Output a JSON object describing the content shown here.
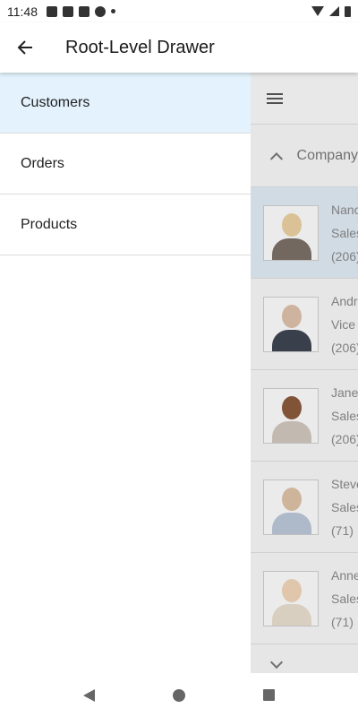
{
  "status_bar": {
    "time": "11:48"
  },
  "app_bar": {
    "title": "Root-Level Drawer",
    "back_icon": "arrow-left-icon"
  },
  "drawer": {
    "items": [
      {
        "label": "Customers",
        "active": true
      },
      {
        "label": "Orders",
        "active": false
      },
      {
        "label": "Products",
        "active": false
      }
    ]
  },
  "underlay": {
    "group_header": "Company",
    "rows": [
      {
        "line1": "Nanc",
        "line2": "Sales",
        "line3": "(206)"
      },
      {
        "line1": "Andr",
        "line2": "Vice",
        "line3": "(206)"
      },
      {
        "line1": "Jane",
        "line2": "Sales",
        "line3": "(206)"
      },
      {
        "line1": "Steve",
        "line2": "Sales",
        "line3": "(71)"
      },
      {
        "line1": "Anne",
        "line2": "Sales",
        "line3": "(71)"
      }
    ]
  },
  "colors": {
    "drawer_active": "#e3f2fd",
    "underlay_selected": "#dfe9f3"
  }
}
